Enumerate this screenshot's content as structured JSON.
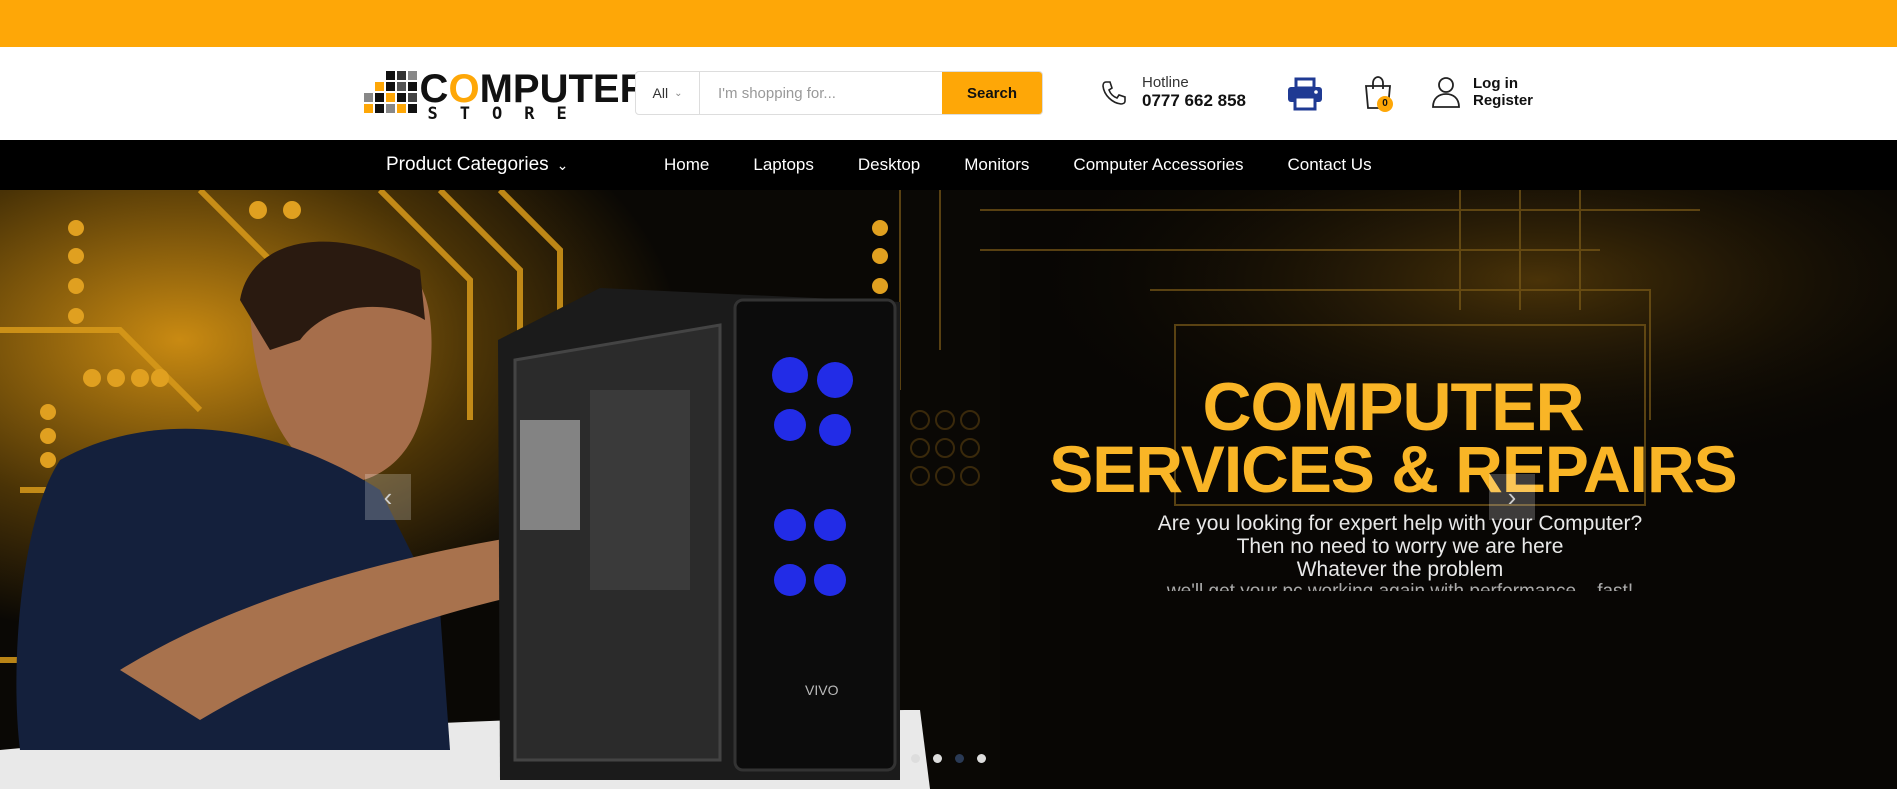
{
  "logo": {
    "main_before": "C",
    "main_o": "O",
    "main_after": "MPUTER",
    "sub": "STORE"
  },
  "search": {
    "category": "All",
    "placeholder": "I'm shopping for...",
    "button": "Search"
  },
  "hotline": {
    "label": "Hotline",
    "number": "0777 662 858"
  },
  "cart": {
    "count": "0"
  },
  "user": {
    "login": "Log in",
    "register": "Register"
  },
  "nav": {
    "categories_label": "Product Categories",
    "links": [
      "Home",
      "Laptops",
      "Desktop",
      "Monitors",
      "Computer Accessories",
      "Contact Us"
    ]
  },
  "hero": {
    "title_line1": "COMPUTER",
    "title_line2": "SERVICES & REPAIRS",
    "desc_line1": "Are you looking for expert help with your Computer?",
    "desc_line2": "Then no need to worry we are here",
    "desc_line3": "Whatever the problem",
    "desc_line4": "we'll get your pc working again with performance – fast!",
    "prev_icon": "chevron-left-icon",
    "next_icon": "chevron-right-icon",
    "case_brand": "VIVO",
    "active_slide": 3,
    "slide_count": 4
  },
  "colors": {
    "accent": "#fea707",
    "nav_bg": "#000000",
    "hero_title": "#f9b526",
    "printer": "#1f3a93"
  }
}
